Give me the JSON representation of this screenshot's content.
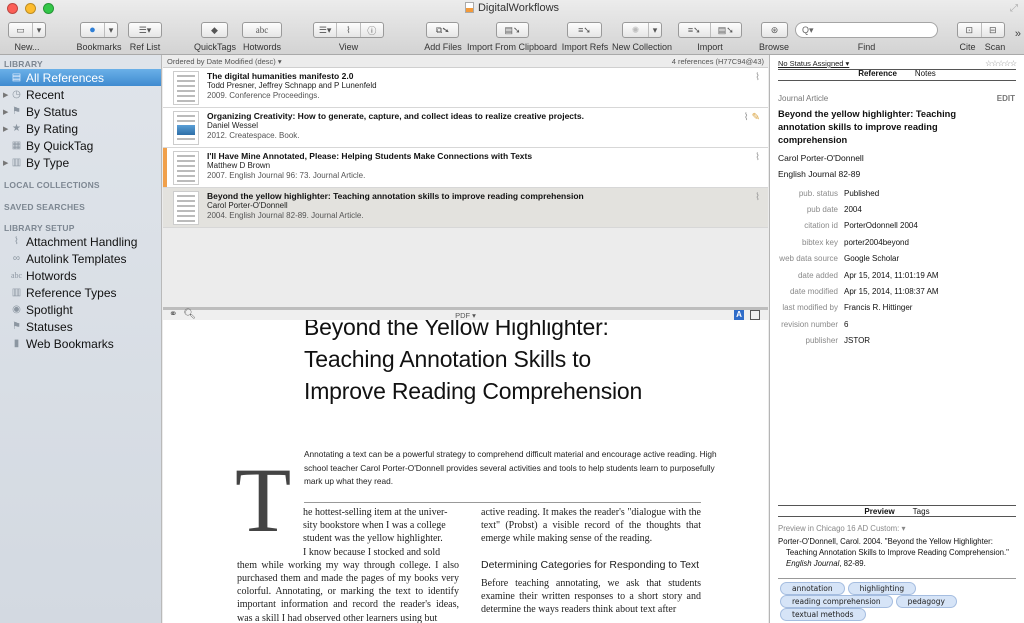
{
  "window": {
    "title": "DigitalWorkflows"
  },
  "toolbar": {
    "buttons": [
      {
        "label": "New...",
        "icon": "new-reference-icon"
      },
      {
        "label": "Bookmarks",
        "icon": "globe-icon"
      },
      {
        "label": "Ref List",
        "icon": "list-icon"
      },
      {
        "label": "QuickTags",
        "icon": "tag-icon"
      },
      {
        "label": "Hotwords",
        "icon": "abc-icon",
        "glyph": "abc"
      },
      {
        "label": "View",
        "icon": "view-icons"
      },
      {
        "label": "Add Files",
        "icon": "add-files-icon"
      },
      {
        "label": "Import From Clipboard",
        "icon": "clipboard-icon"
      },
      {
        "label": "Import Refs",
        "icon": "import-refs-icon"
      },
      {
        "label": "New Collection",
        "icon": "gear-icon"
      },
      {
        "label": "Import",
        "icon": "import-icon"
      },
      {
        "label": "Browse",
        "icon": "browse-icon"
      },
      {
        "label": "Find",
        "icon": "search-icon"
      },
      {
        "label": "Cite",
        "icon": "cite-icon"
      },
      {
        "label": "Scan",
        "icon": "scan-icon"
      }
    ],
    "search_placeholder": "Q▾"
  },
  "sidebar": {
    "library_heading": "LIBRARY",
    "library_items": [
      {
        "label": "All References",
        "icon": "▤",
        "active": true,
        "expandable": false
      },
      {
        "label": "Recent",
        "icon": "◷",
        "expandable": true
      },
      {
        "label": "By Status",
        "icon": "⚑",
        "expandable": true
      },
      {
        "label": "By Rating",
        "icon": "★",
        "expandable": true
      },
      {
        "label": "By QuickTag",
        "icon": "▦",
        "expandable": false
      },
      {
        "label": "By Type",
        "icon": "▥",
        "expandable": true
      }
    ],
    "local_collections_heading": "LOCAL COLLECTIONS",
    "saved_searches_heading": "SAVED SEARCHES",
    "setup_heading": "LIBRARY SETUP",
    "setup_items": [
      {
        "label": "Attachment Handling",
        "icon": "⌇"
      },
      {
        "label": "Autolink Templates",
        "icon": "∞"
      },
      {
        "label": "Hotwords",
        "icon": "abc"
      },
      {
        "label": "Reference Types",
        "icon": "▥"
      },
      {
        "label": "Spotlight",
        "icon": "◉"
      },
      {
        "label": "Statuses",
        "icon": "⚑"
      },
      {
        "label": "Web Bookmarks",
        "icon": "▮"
      }
    ]
  },
  "list": {
    "sort_label": "Ordered by Date Modified (desc) ▾",
    "count_label": "4 references (H77C94@43)",
    "references": [
      {
        "title": "The digital humanities manifesto 2.0",
        "authors": "Todd Presner, Jeffrey Schnapp and P Lunenfeld",
        "meta": "2009.  Conference Proceedings.",
        "attachment": true,
        "edited": false,
        "flag_color": "",
        "selected": false
      },
      {
        "title": "Organizing Creativity: How to generate, capture, and collect ideas to realize creative projects.",
        "authors": "Daniel Wessel",
        "meta": "2012.  Createspace.  Book.",
        "attachment": true,
        "edited": true,
        "flag_color": "",
        "selected": false
      },
      {
        "title": "I'll Have Mine Annotated, Please: Helping Students Make Connections with Texts",
        "authors": "Matthew D Brown",
        "meta": "2007.  English Journal 96: 73.  Journal Article.",
        "attachment": true,
        "edited": false,
        "flag_color": "#f0a04b",
        "selected": false
      },
      {
        "title": "Beyond the yellow highlighter: Teaching annotation skills to improve reading comprehension",
        "authors": "Carol Porter-O'Donnell",
        "meta": "2004.  English Journal 82-89.  Journal Article.",
        "attachment": true,
        "edited": false,
        "flag_color": "",
        "selected": true
      }
    ]
  },
  "pdf_toolbar": {
    "format_label": "PDF ▾",
    "text_mode_label": "A"
  },
  "pdf": {
    "title_lines": [
      "Beyond the Yellow Highlighter:",
      "Teaching Annotation Skills to",
      "Improve Reading Comprehension"
    ],
    "abstract": "Annotating a text can be a powerful strategy to comprehend difficult material and encourage active reading. High school teacher Carol Porter-O'Donnell provides several activities and tools to help students learn to purposefully mark up what they read.",
    "drop_cap": "T",
    "col1_indented": [
      "he hottest-selling item at the univer-",
      "sity bookstore when I was a college",
      "student was the yellow highlighter.",
      "I know because I stocked and sold"
    ],
    "col1_body": "them while working my way through college. I also purchased them and made the pages of my books very colorful. Annotating, or marking the text to identify important information and record the reader's ideas, was a skill I had observed other learners using but",
    "col2_p1": "active reading. It makes the reader's \"dialogue with the text\" (Probst) a visible record of the thoughts that emerge while making sense of the reading.",
    "col2_heading": "Determining Categories for Responding to Text",
    "col2_p2": "Before teaching annotating, we ask that students examine their written responses to a short story and determine the ways readers think about text after"
  },
  "inspector": {
    "status": "No Status Assigned ▾",
    "rating": "☆☆☆☆☆",
    "tabs": [
      {
        "label": "Reference",
        "active": true
      },
      {
        "label": "Notes",
        "active": false
      }
    ],
    "type": "Journal Article",
    "edit_label": "EDIT",
    "title": "Beyond the yellow highlighter: Teaching annotation skills to improve reading comprehension",
    "author": "Carol Porter-O'Donnell",
    "journal": "English Journal 82-89",
    "fields": [
      {
        "key": "pub. status",
        "value": "Published"
      },
      {
        "key": "pub date",
        "value": "2004"
      },
      {
        "key": "citation id",
        "value": "PorterOdonnell 2004"
      },
      {
        "key": "bibtex key",
        "value": "porter2004beyond"
      },
      {
        "key": "web data source",
        "value": "Google Scholar"
      },
      {
        "key": "date added",
        "value": "Apr 15, 2014, 11:01:19 AM"
      },
      {
        "key": "date modified",
        "value": "Apr 15, 2014, 11:08:37 AM"
      },
      {
        "key": "last modified by",
        "value": "Francis R. Hittinger"
      },
      {
        "key": "revision number",
        "value": "6"
      },
      {
        "key": "publisher",
        "value": "JSTOR"
      }
    ],
    "preview_tabs": [
      {
        "label": "Preview",
        "active": true
      },
      {
        "label": "Tags",
        "active": false
      }
    ],
    "preview_style": "Preview in Chicago 16 AD Custom:  ▾",
    "preview_text_before": "Porter-O'Donnell, Carol. 2004. \"Beyond the Yellow Highlighter: Teaching Annotation Skills to Improve Reading Comprehension.\" ",
    "preview_journal": "English Journal",
    "preview_text_after": ", 82-89.",
    "tags": [
      "annotation",
      "highlighting",
      "reading comprehension",
      "pedagogy",
      "textual methods"
    ]
  }
}
